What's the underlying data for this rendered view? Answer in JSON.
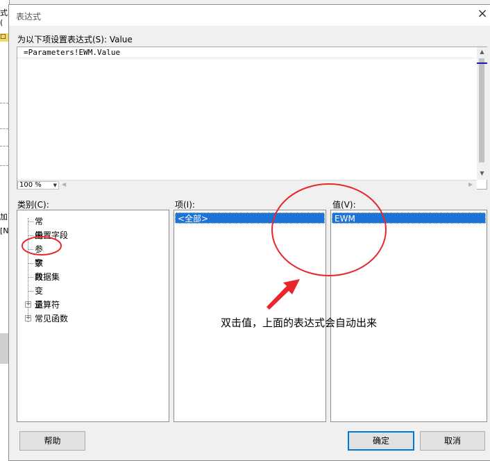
{
  "dialog": {
    "title": "表达式",
    "close_glyph": "×"
  },
  "background_app": {
    "labels": [
      "式(",
      "□",
      "加",
      "[N"
    ]
  },
  "expression": {
    "label": "为以下项设置表达式(S): Value",
    "value": "=Parameters!EWM.Value",
    "zoom": "100 %"
  },
  "category": {
    "label": "类别(C):",
    "items": [
      {
        "label": "常量",
        "expandable": false
      },
      {
        "label": "内置字段",
        "expandable": false
      },
      {
        "label": "参数",
        "expandable": false
      },
      {
        "label": "字段",
        "expandable": false
      },
      {
        "label": "数据集",
        "expandable": false
      },
      {
        "label": "变量",
        "expandable": false
      },
      {
        "label": "运算符",
        "expandable": true
      },
      {
        "label": "常见函数",
        "expandable": true
      }
    ]
  },
  "items_pane": {
    "label": "项(I):",
    "selected": "<全部>"
  },
  "values_pane": {
    "label": "值(V):",
    "selected": "EWM"
  },
  "buttons": {
    "help": "帮助",
    "ok": "确定",
    "cancel": "取消"
  },
  "annotation": {
    "text": "双击值，上面的表达式会自动出来",
    "color": "#e8262b"
  },
  "colors": {
    "selection": "#1e74d6",
    "focus_border": "#0078d7"
  },
  "icons": {
    "expander": "plus-box-icon",
    "scroll_up": "triangle-up-icon",
    "scroll_down": "triangle-down-icon",
    "dropdown": "triangle-down-icon"
  }
}
